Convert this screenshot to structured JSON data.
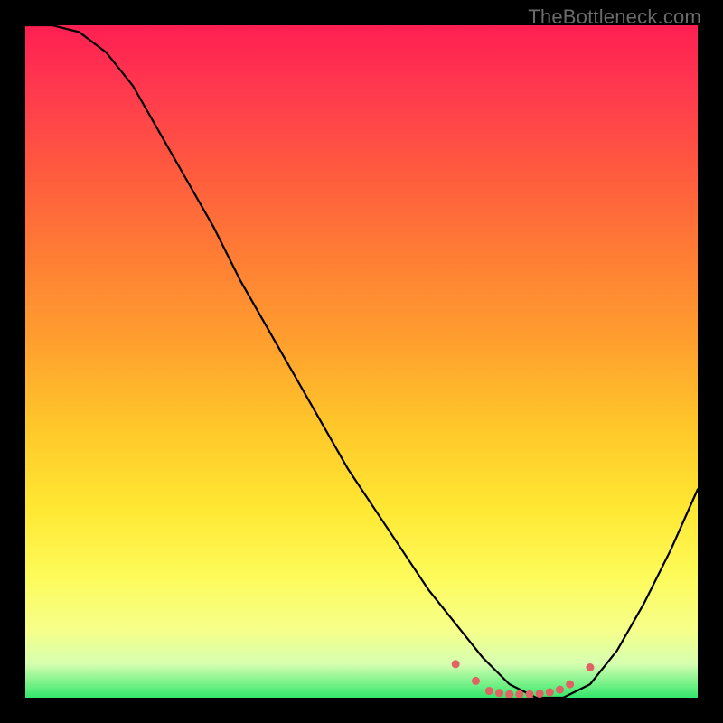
{
  "watermark": "TheBottleneck.com",
  "colors": {
    "frame_bg": "#000000",
    "curve_stroke": "#000000",
    "marker_fill": "#e06262",
    "watermark_fg": "#6b6b6b",
    "gradient_top": "#ff1f52",
    "gradient_bottom": "#33e76c"
  },
  "chart_data": {
    "type": "line",
    "title": "",
    "xlabel": "",
    "ylabel": "",
    "x_range": [
      0,
      100
    ],
    "y_range": [
      0,
      100
    ],
    "grid": false,
    "legend": "none",
    "note": "Axes are unlabeled; x and y are normalized 0–100. The curve resembles a bottleneck/mismatch chart: high values on the left descending to a flat low valley around x≈70–80, then rising again. Values are read from the plotted curve relative to the frame.",
    "curve": {
      "name": "bottleneck-curve",
      "x": [
        0,
        4,
        8,
        12,
        16,
        20,
        24,
        28,
        32,
        36,
        40,
        44,
        48,
        52,
        56,
        60,
        64,
        68,
        72,
        76,
        80,
        84,
        88,
        92,
        96,
        100
      ],
      "y": [
        100,
        100,
        99,
        96,
        91,
        84,
        77,
        70,
        62,
        55,
        48,
        41,
        34,
        28,
        22,
        16,
        11,
        6,
        2,
        0,
        0,
        2,
        7,
        14,
        22,
        31
      ]
    },
    "markers": {
      "name": "valley-dots",
      "note": "Small points along the flat bottom of the valley and at its edges.",
      "x": [
        64,
        67,
        69,
        70.5,
        72,
        73.5,
        75,
        76.5,
        78,
        79.5,
        81,
        84
      ],
      "y": [
        5,
        2.5,
        1,
        0.7,
        0.5,
        0.5,
        0.5,
        0.6,
        0.8,
        1.2,
        2,
        4.5
      ]
    }
  }
}
